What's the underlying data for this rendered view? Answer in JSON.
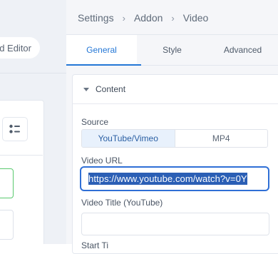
{
  "left_pane": {
    "editor_pill_label": "d Editor"
  },
  "breadcrumb": {
    "items": [
      "Settings",
      "Addon",
      "Video"
    ],
    "separator": "›"
  },
  "tabs": [
    {
      "label": "General",
      "active": true
    },
    {
      "label": "Style",
      "active": false
    },
    {
      "label": "Advanced",
      "active": false
    }
  ],
  "content": {
    "section_title": "Content",
    "source": {
      "label": "Source",
      "options": [
        "YouTube/Vimeo",
        "MP4"
      ],
      "selected": "YouTube/Vimeo"
    },
    "video_url": {
      "label": "Video URL",
      "value": "https://www.youtube.com/watch?v=0Y"
    },
    "video_title": {
      "label": "Video Title (YouTube)",
      "value": ""
    },
    "start_time": {
      "label": "Start Ti"
    }
  },
  "colors": {
    "accent": "#2477d6",
    "selection": "#2b5fb5",
    "focus_border": "#2f6fd6",
    "green_border": "#59c96e"
  }
}
